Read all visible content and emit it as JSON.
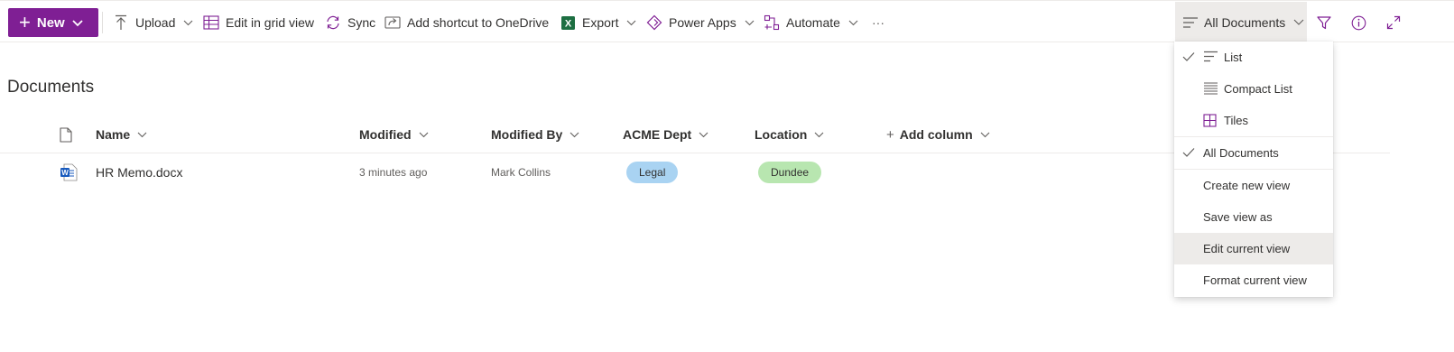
{
  "toolbar": {
    "new_label": "New",
    "upload_label": "Upload",
    "grid_label": "Edit in grid view",
    "sync_label": "Sync",
    "shortcut_label": "Add shortcut to OneDrive",
    "export_label": "Export",
    "powerapps_label": "Power Apps",
    "automate_label": "Automate",
    "more_label": "···",
    "view_label": "All Documents"
  },
  "page": {
    "title": "Documents"
  },
  "columns": {
    "name": "Name",
    "modified": "Modified",
    "modified_by": "Modified By",
    "dept": "ACME Dept",
    "location": "Location",
    "add": "Add column"
  },
  "rows": [
    {
      "name": "HR Memo.docx",
      "modified": "3 minutes ago",
      "modified_by": "Mark Collins",
      "dept": "Legal",
      "location": "Dundee"
    }
  ],
  "menu": {
    "list": "List",
    "compact": "Compact List",
    "tiles": "Tiles",
    "all_docs": "All Documents",
    "create": "Create new view",
    "save_as": "Save view as",
    "edit": "Edit current view",
    "format": "Format current view"
  },
  "colors": {
    "brand": "#7f1f94",
    "dept_pill": "#a9d3f2",
    "location_pill": "#b8e6b0",
    "word_blue": "#185abd",
    "excel_green": "#1d6f42"
  },
  "icons": {
    "upload": "upload-icon",
    "grid": "grid-icon",
    "sync": "sync-icon",
    "shortcut": "shortcut-icon",
    "export": "excel-icon",
    "powerapps": "powerapps-icon",
    "automate": "automate-icon",
    "filter": "filter-icon",
    "info": "info-icon",
    "expand": "expand-icon"
  }
}
